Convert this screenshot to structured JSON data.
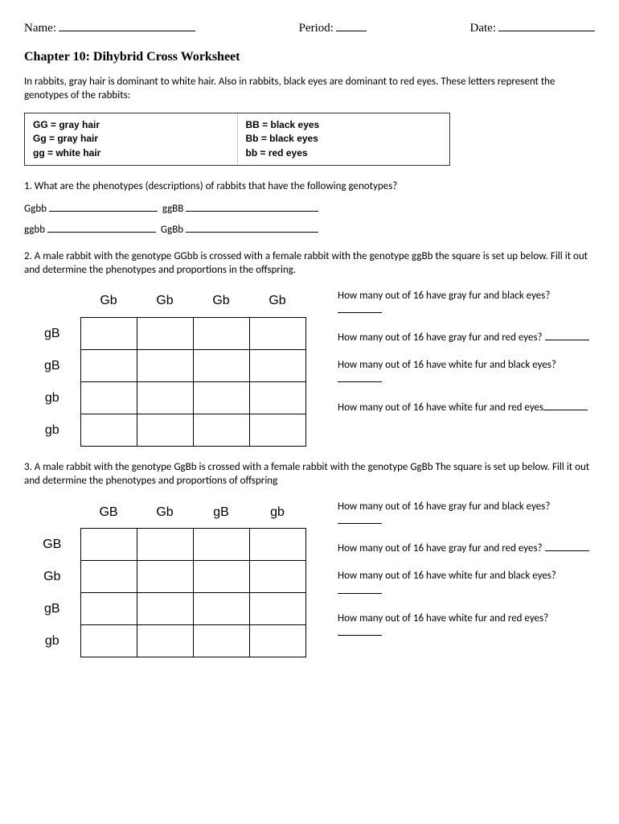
{
  "header": {
    "name_label": "Name:",
    "period_label": "Period:",
    "date_label": "Date:"
  },
  "title": "Chapter 10: Dihybrid Cross Worksheet",
  "intro": "In rabbits, gray hair is dominant to white hair. Also in rabbits, black eyes are dominant to red eyes. These letters represent the genotypes of the rabbits:",
  "key": {
    "col1": [
      "GG = gray hair",
      "Gg = gray hair",
      "gg = white hair"
    ],
    "col2": [
      "BB = black eyes",
      "Bb = black eyes",
      "bb = red eyes"
    ]
  },
  "q1": {
    "text": "1. What are the phenotypes (descriptions) of rabbits that have the following genotypes?",
    "row1": {
      "g1": "Ggbb",
      "g2": "ggBB"
    },
    "row2": {
      "g1": "ggbb",
      "g2": "GgBb"
    }
  },
  "q2": {
    "text": "2. A male rabbit with the genotype GGbb is crossed with a female rabbit with the genotype ggBb the square is set up below. Fill it out and determine the phenotypes and proportions in the offspring.",
    "cols": [
      "Gb",
      "Gb",
      "Gb",
      "Gb"
    ],
    "rows": [
      "gB",
      "gB",
      "gb",
      "gb"
    ],
    "questions": {
      "a": "How many out of 16 have gray fur and black eyes?",
      "b": "How many out of 16 have gray fur and red eyes?",
      "c": "How many out of 16 have white fur and black eyes?",
      "d": "How many out of 16 have white fur and red eyes"
    }
  },
  "q3": {
    "text": "3. A male rabbit with the genotype GgBb is crossed with a female rabbit with the genotype GgBb The square is set up below. Fill it out and determine the phenotypes and proportions of offspring",
    "cols": [
      "GB",
      "Gb",
      "gB",
      "gb"
    ],
    "rows": [
      "GB",
      "Gb",
      "gB",
      "gb"
    ],
    "questions": {
      "a": "How many out of 16 have gray fur and black eyes?",
      "b": "How many out of 16 have gray fur and red eyes?",
      "c": "How many out of 16 have white fur and black eyes?",
      "d": "How many out of 16 have white fur and red eyes?"
    }
  }
}
